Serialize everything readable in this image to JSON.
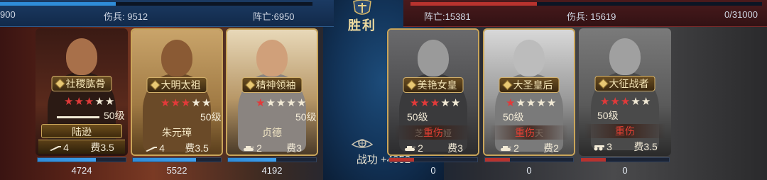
{
  "top": {
    "left": {
      "hp_fraction": 0.37,
      "troops": "900",
      "wounded": "伤兵: 9512",
      "killed": "阵亡:6950"
    },
    "right": {
      "hp_fraction": 0.36,
      "killed": "阵亡:15381",
      "wounded": "伤兵: 15619",
      "troops": "0/31000"
    },
    "result": "胜利",
    "merit": "战功 +4052"
  },
  "colors": {
    "ally": "#2f8cd8",
    "enemy": "#b8332e",
    "gold": "#c9a55a",
    "dead_text": "#e34034"
  },
  "ally_cards": [
    {
      "title": "社稷肱骨",
      "stars_filled": 3,
      "stars_total": 5,
      "level": "50级",
      "name": "陆逊",
      "unit_icon": "rifle-icon",
      "unit_value": "4",
      "cost": "费3.5",
      "troop_fraction": 0.66,
      "troops": "4724"
    },
    {
      "title": "大明太祖",
      "stars_filled": 3,
      "stars_total": 5,
      "level": "50级",
      "name": "朱元璋",
      "unit_icon": "rifle-icon",
      "unit_value": "4",
      "cost": "费3.5",
      "troop_fraction": 0.72,
      "troops": "5522"
    },
    {
      "title": "精神领袖",
      "stars_filled": 1,
      "stars_total": 5,
      "level": "50级",
      "name": "贞德",
      "unit_icon": "tank-icon",
      "unit_value": "2",
      "cost": "费3",
      "troop_fraction": 0.55,
      "troops": "4192"
    }
  ],
  "enemy_cards": [
    {
      "title": "美艳女皇",
      "stars_filled": 3,
      "stars_total": 5,
      "level": "50级",
      "status": "重伤",
      "ghost_left": "芝",
      "ghost_right": "娅",
      "unit_icon": "tank-icon",
      "unit_value": "2",
      "cost": "费3",
      "troop_fraction": 0.0,
      "troops": "0"
    },
    {
      "title": "大圣皇后",
      "stars_filled": 1,
      "stars_total": 5,
      "level": "50级",
      "status": "重伤",
      "ghost_left": "",
      "ghost_right": "天",
      "unit_icon": "tank-icon",
      "unit_value": "2",
      "cost": "费2",
      "troop_fraction": 0.0,
      "troops": "0"
    },
    {
      "title": "大征战者",
      "stars_filled": 3,
      "stars_total": 5,
      "level": "50级",
      "status": "重伤",
      "ghost_left": "",
      "ghost_right": "",
      "unit_icon": "cannon-icon",
      "unit_value": "3",
      "cost": "费3.5",
      "troop_fraction": 0.0,
      "troops": "0"
    }
  ]
}
